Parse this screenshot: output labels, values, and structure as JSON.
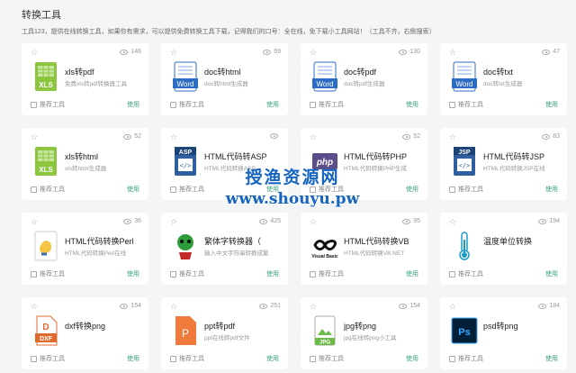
{
  "header": {
    "title": "转换工具",
    "description": "工具123，提供在线转换工具，如果你有需求，可以提供免费转换工具下载，记得我们的口号：全在线，免下载小工具网站！（工具不齐，右侧搜索）"
  },
  "common": {
    "recommend_label": "推荐工具",
    "use_label": "使用"
  },
  "cards": [
    {
      "name": "xls转pdf",
      "sub": "免费xls转pdf转换器工具",
      "views": "146",
      "icon": "excel-icon"
    },
    {
      "name": "doc转html",
      "sub": "doc转html生成器",
      "views": "69",
      "icon": "word-icon"
    },
    {
      "name": "doc转pdf",
      "sub": "doc转pdf生成器",
      "views": "130",
      "icon": "word-icon"
    },
    {
      "name": "doc转txt",
      "sub": "doc转txt生成器",
      "views": "47",
      "icon": "word-icon"
    },
    {
      "name": "xls转html",
      "sub": "xls转html生成器",
      "views": "52",
      "icon": "excel-icon"
    },
    {
      "name": "HTML代码转ASP",
      "sub": "HTML代码转换ASP",
      "views": "",
      "icon": "asp-icon"
    },
    {
      "name": "HTML代码转PHP",
      "sub": "HTML代码转换PHP生成",
      "views": "52",
      "icon": "php-icon"
    },
    {
      "name": "HTML代码转JSP",
      "sub": "HTML代码转换JSP在线",
      "views": "83",
      "icon": "jsp-icon"
    },
    {
      "name": "HTML代码转换Perl",
      "sub": "HTML代码转换Perl在线",
      "views": "36",
      "icon": "perl-icon"
    },
    {
      "name": "繁体字转换器（",
      "sub": "输入中文字符串转换成繁",
      "views": "425",
      "icon": "monster-icon"
    },
    {
      "name": "HTML代码转换VB",
      "sub": "HTML代码转换VB.NET",
      "views": "95",
      "icon": "vb-icon"
    },
    {
      "name": "温度单位转换",
      "sub": "",
      "views": "194",
      "icon": "thermometer-icon"
    },
    {
      "name": "dxf转换png",
      "sub": "",
      "views": "154",
      "icon": "dxf-icon"
    },
    {
      "name": "ppt转pdf",
      "sub": "ppt在线转pdf文件",
      "views": "251",
      "icon": "ppt-icon"
    },
    {
      "name": "jpg转png",
      "sub": "jpg在线转png小工具",
      "views": "154",
      "icon": "jpg-icon"
    },
    {
      "name": "psd转png",
      "sub": "",
      "views": "184",
      "icon": "psd-icon"
    }
  ],
  "watermark": {
    "line1": "授渔资源网",
    "line2": "www.shouyu.pw"
  },
  "colors": {
    "use_green": "#3aa57a",
    "word_blue": "#2b6cc4",
    "excel_green": "#8cc63f",
    "ppt_orange": "#f07a3c",
    "psd_blue": "#001e36"
  }
}
